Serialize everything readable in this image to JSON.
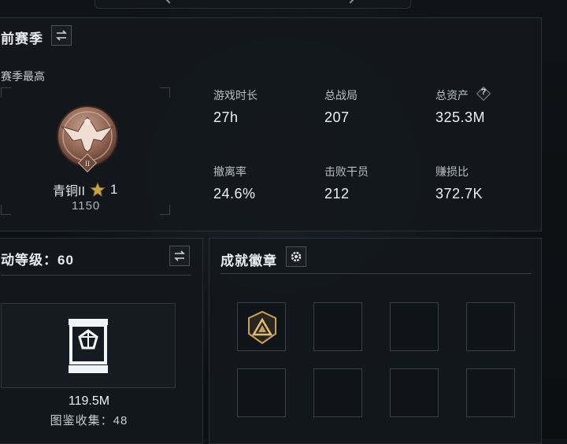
{
  "season": {
    "title": "前赛季",
    "subtitle": "赛季最高",
    "rank_name": "青铜II",
    "rank_stars": "1",
    "rank_score": "1150",
    "stats": [
      {
        "label": "游戏时长",
        "value": "27h"
      },
      {
        "label": "总战局",
        "value": "207"
      },
      {
        "label": "总资产",
        "value": "325.3M"
      },
      {
        "label": "撤离率",
        "value": "24.6%"
      },
      {
        "label": "击败干员",
        "value": "212"
      },
      {
        "label": "赚损比",
        "value": "372.7K"
      }
    ],
    "help_glyph": "?"
  },
  "level": {
    "title": "动等级：60",
    "value": "119.5M",
    "collection": "图鉴收集：48"
  },
  "badges": {
    "title": "成就徽章",
    "slot_count": 8
  },
  "colors": {
    "bronze": "#9a6c58",
    "gold_star": "#c9a24a",
    "badge_gold": "#c9a05a"
  }
}
